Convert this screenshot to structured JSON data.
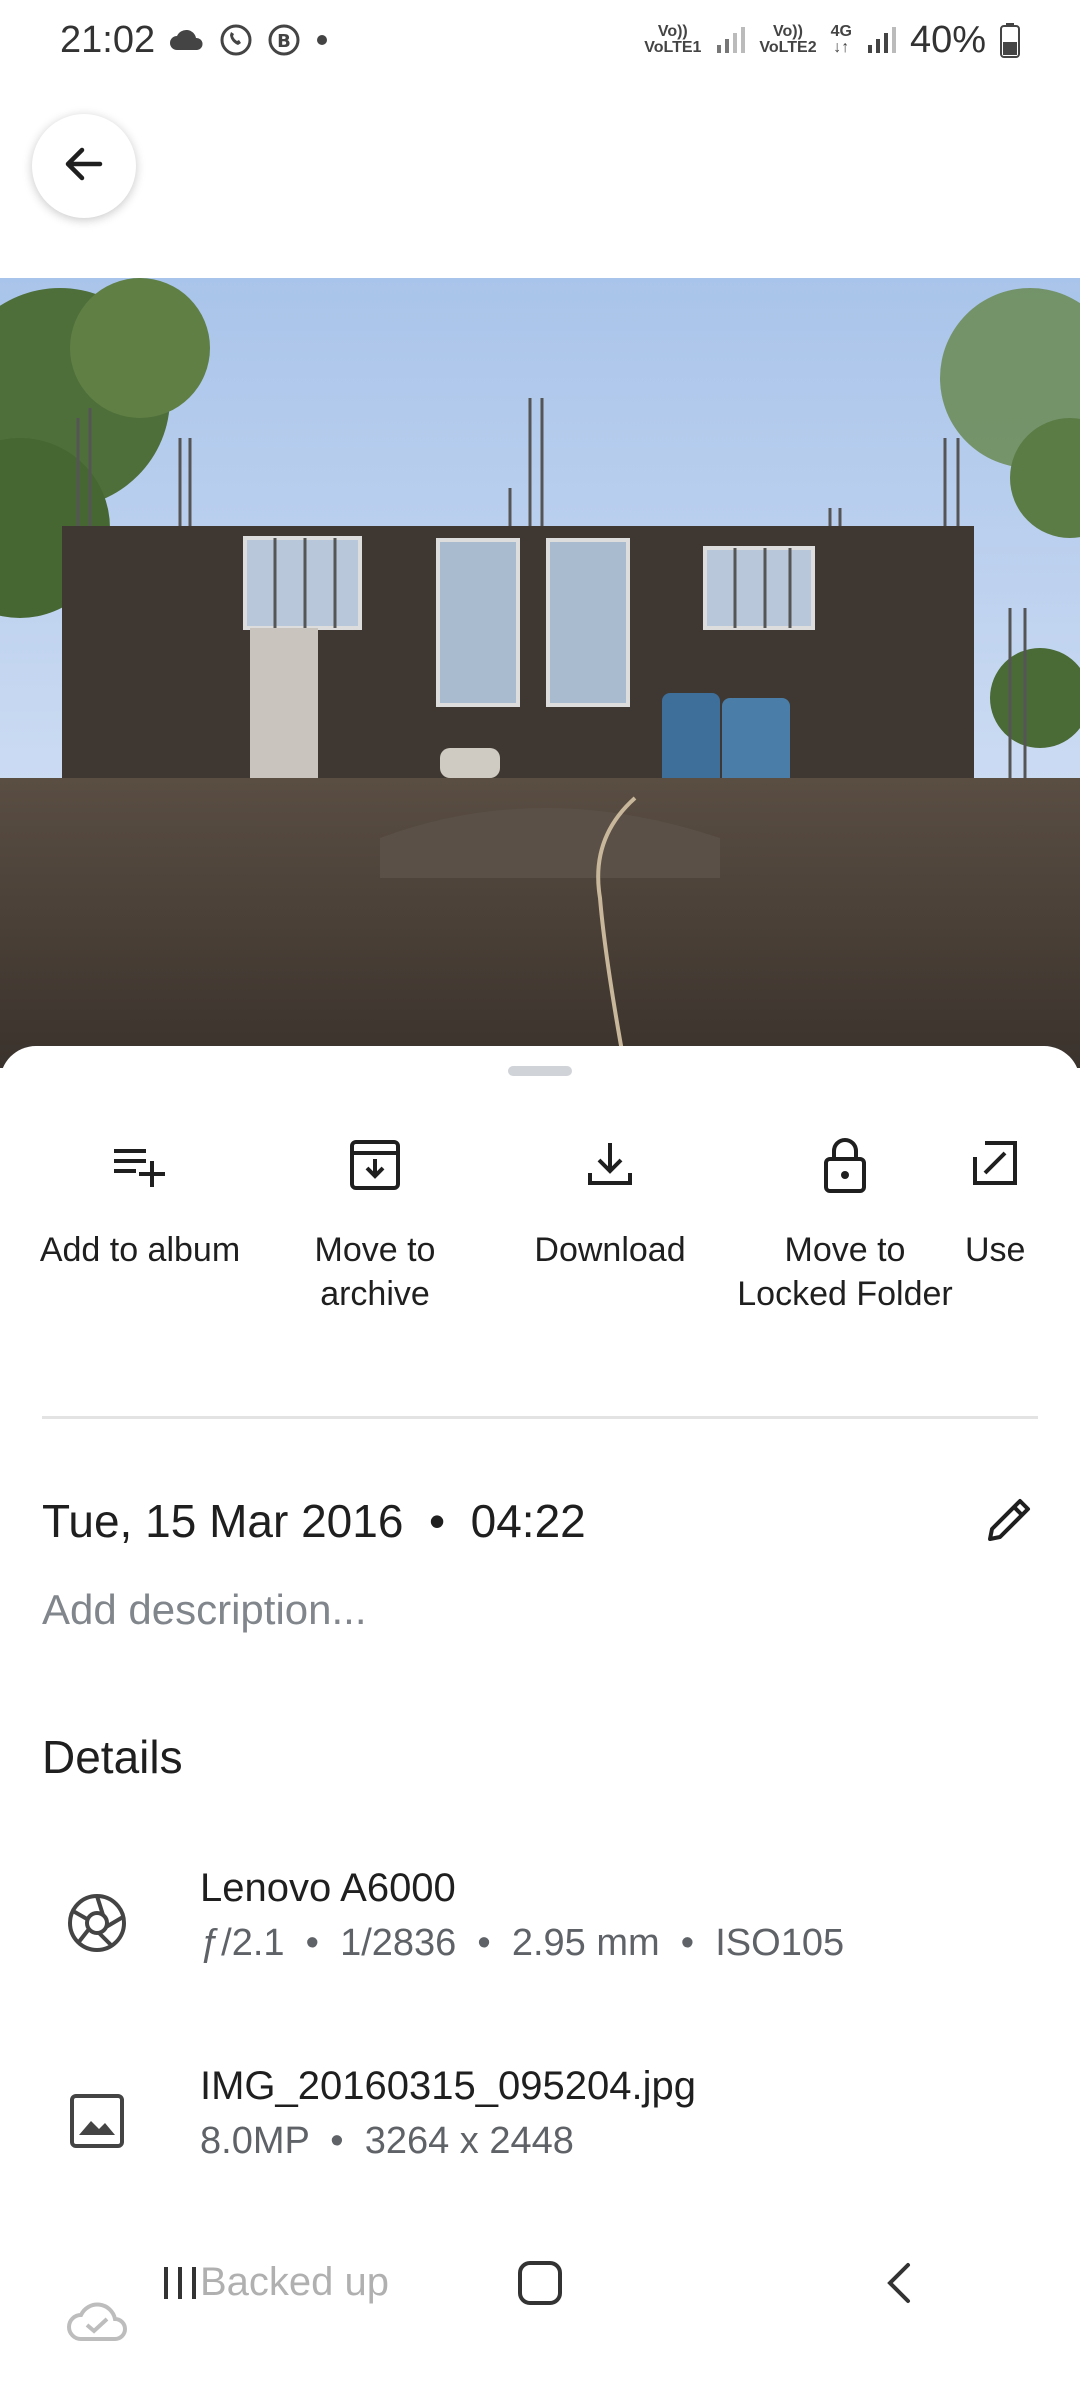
{
  "status_bar": {
    "time": "21:02",
    "network1": "VoLTE1",
    "network2": "VoLTE2",
    "network_type": "4G",
    "battery": "40%"
  },
  "photo_viewer": {
    "back_icon": "arrow-back-icon"
  },
  "actions": [
    {
      "label": "Add to album",
      "icon": "playlist-add-icon"
    },
    {
      "label": "Move to archive",
      "icon": "archive-icon"
    },
    {
      "label": "Download",
      "icon": "download-icon"
    },
    {
      "label": "Move to Locked Folder",
      "icon": "lock-icon"
    },
    {
      "label": "Use",
      "icon": "open-in-new-icon"
    }
  ],
  "info": {
    "date": "Tue, 15 Mar 2016",
    "time": "04:22",
    "description_placeholder": "Add description..."
  },
  "details": {
    "title": "Details",
    "camera": {
      "model": "Lenovo A6000",
      "aperture": "ƒ/2.1",
      "shutter": "1/2836",
      "focal_length": "2.95 mm",
      "iso": "ISO105"
    },
    "file": {
      "name": "IMG_20160315_095204.jpg",
      "megapixels": "8.0MP",
      "resolution": "3264 x 2448"
    },
    "backup": {
      "status": "Backed up"
    }
  },
  "colors": {
    "sky": "#bcd3ef",
    "wall": "#3f3732",
    "ground": "#4a3f36",
    "accent_text": "#1f1f1f",
    "secondary_text": "#5f6368"
  }
}
